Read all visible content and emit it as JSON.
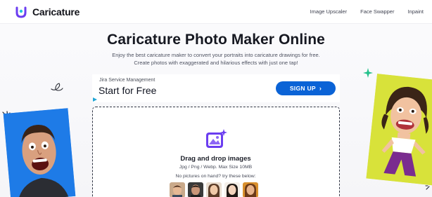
{
  "header": {
    "brand_name": "Caricature",
    "nav": [
      {
        "label": "Image Upscaler"
      },
      {
        "label": "Face Swapper"
      },
      {
        "label": "Inpaint"
      }
    ]
  },
  "hero": {
    "title": "Caricature Photo Maker Online",
    "subtitle_line1": "Enjoy the best caricature maker to convert your portraits into caricature drawings for free.",
    "subtitle_line2": "Create photos with exaggerated and hilarious effects with just one tap!"
  },
  "ad": {
    "kicker": "Jira Service Management",
    "headline": "Start for Free",
    "button_label": "SIGN UP",
    "button_color": "#0b63d6"
  },
  "upload": {
    "title": "Drag and drop images",
    "formats": "Jpg / Png / Webp. Max Size 10MB",
    "hint": "No pictures on hand? try these below:",
    "sample_count_visible": 5
  },
  "colors": {
    "brand_accent": "#6b3df0",
    "left_photo_bg": "#1e7be7",
    "right_photo_bg": "#d8e23a",
    "star": "#22c08a"
  },
  "icons": {
    "brand": "caricature-logo-icon",
    "upload": "image-upload-icon",
    "ad_button": "chevron-right-icon"
  }
}
